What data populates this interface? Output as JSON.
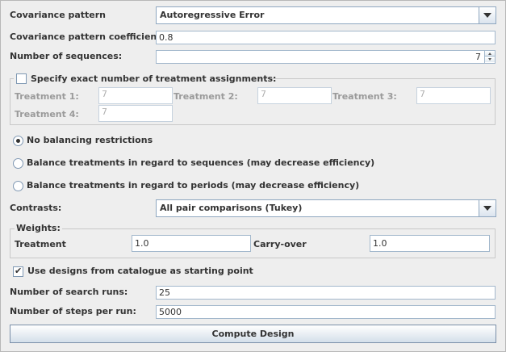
{
  "covariance": {
    "pattern_label": "Covariance pattern",
    "pattern_value": "Autoregressive Error",
    "coefficient_label": "Covariance pattern coefficient",
    "coefficient_value": "0.8"
  },
  "sequences": {
    "label": "Number of sequences:",
    "value": "7"
  },
  "treatment_assignments": {
    "checkbox_label": "Specify exact number of treatment assignments:",
    "checked": false,
    "treatments": [
      {
        "label": "Treatment 1:",
        "value": "7"
      },
      {
        "label": "Treatment 2:",
        "value": "7"
      },
      {
        "label": "Treatment 3:",
        "value": "7"
      },
      {
        "label": "Treatment 4:",
        "value": "7"
      }
    ]
  },
  "balancing": {
    "options": [
      {
        "label": "No balancing restrictions",
        "selected": true
      },
      {
        "label": "Balance treatments in regard to sequences (may decrease efficiency)",
        "selected": false
      },
      {
        "label": "Balance treatments in regard to periods (may decrease efficiency)",
        "selected": false
      }
    ]
  },
  "contrasts": {
    "label": "Contrasts:",
    "value": "All pair comparisons (Tukey)"
  },
  "weights": {
    "title": "Weights:",
    "treatment_label": "Treatment",
    "treatment_value": "1.0",
    "carryover_label": "Carry-over",
    "carryover_value": "1.0"
  },
  "catalogue": {
    "label": "Use designs from catalogue as starting point",
    "checked": true
  },
  "search": {
    "runs_label": "Number of search runs:",
    "runs_value": "25",
    "steps_label": "Number of steps per run:",
    "steps_value": "5000"
  },
  "compute_button": "Compute Design",
  "icons": {
    "dropdown": "chevron-down-icon",
    "spinner_up": "arrow-up-icon",
    "spinner_down": "arrow-down-icon",
    "check": "checkmark-icon"
  }
}
